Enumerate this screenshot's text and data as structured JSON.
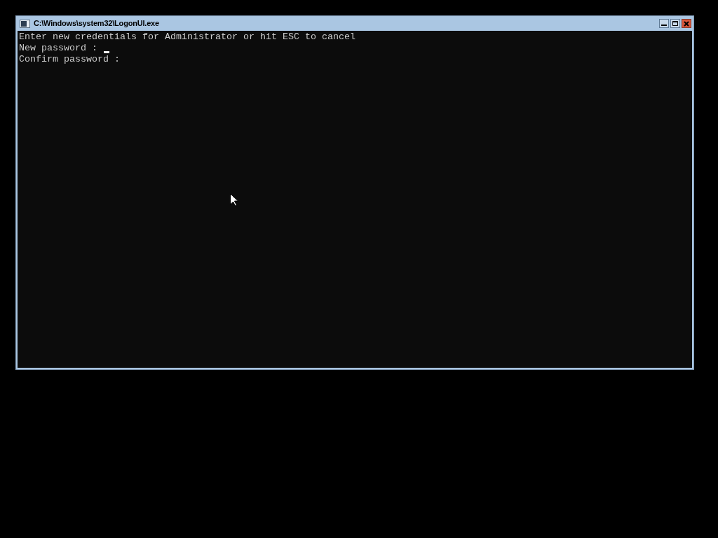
{
  "window": {
    "title": "C:\\Windows\\system32\\LogonUI.exe"
  },
  "console": {
    "lines": [
      {
        "text": "Enter new credentials for Administrator or hit ESC to cancel",
        "cursor": false
      },
      {
        "text": "New password : ",
        "cursor": true
      },
      {
        "text": "Confirm password :",
        "cursor": false
      }
    ]
  }
}
